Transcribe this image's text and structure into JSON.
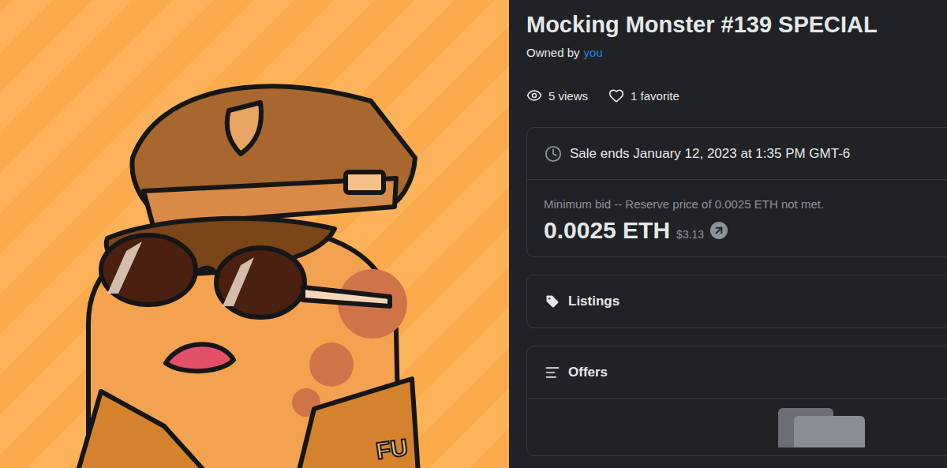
{
  "nft": {
    "title": "Mocking Monster #139 SPECIAL",
    "owned_by_label": "Owned by",
    "owner": "you"
  },
  "stats": [
    {
      "kind": "views",
      "label": "5 views"
    },
    {
      "kind": "favorites",
      "label": "1 favorite"
    }
  ],
  "sale": {
    "ends": "Sale ends January 12, 2023 at 1:35 PM GMT-6",
    "bid_note": "Minimum bid -- Reserve price of 0.0025 ETH not met.",
    "price": "0.0025 ETH",
    "usd": "$3.13"
  },
  "sections": [
    {
      "kind": "listings",
      "label": "Listings"
    },
    {
      "kind": "offers",
      "label": "Offers"
    }
  ],
  "artwork": {
    "jacket_text": "FU"
  }
}
